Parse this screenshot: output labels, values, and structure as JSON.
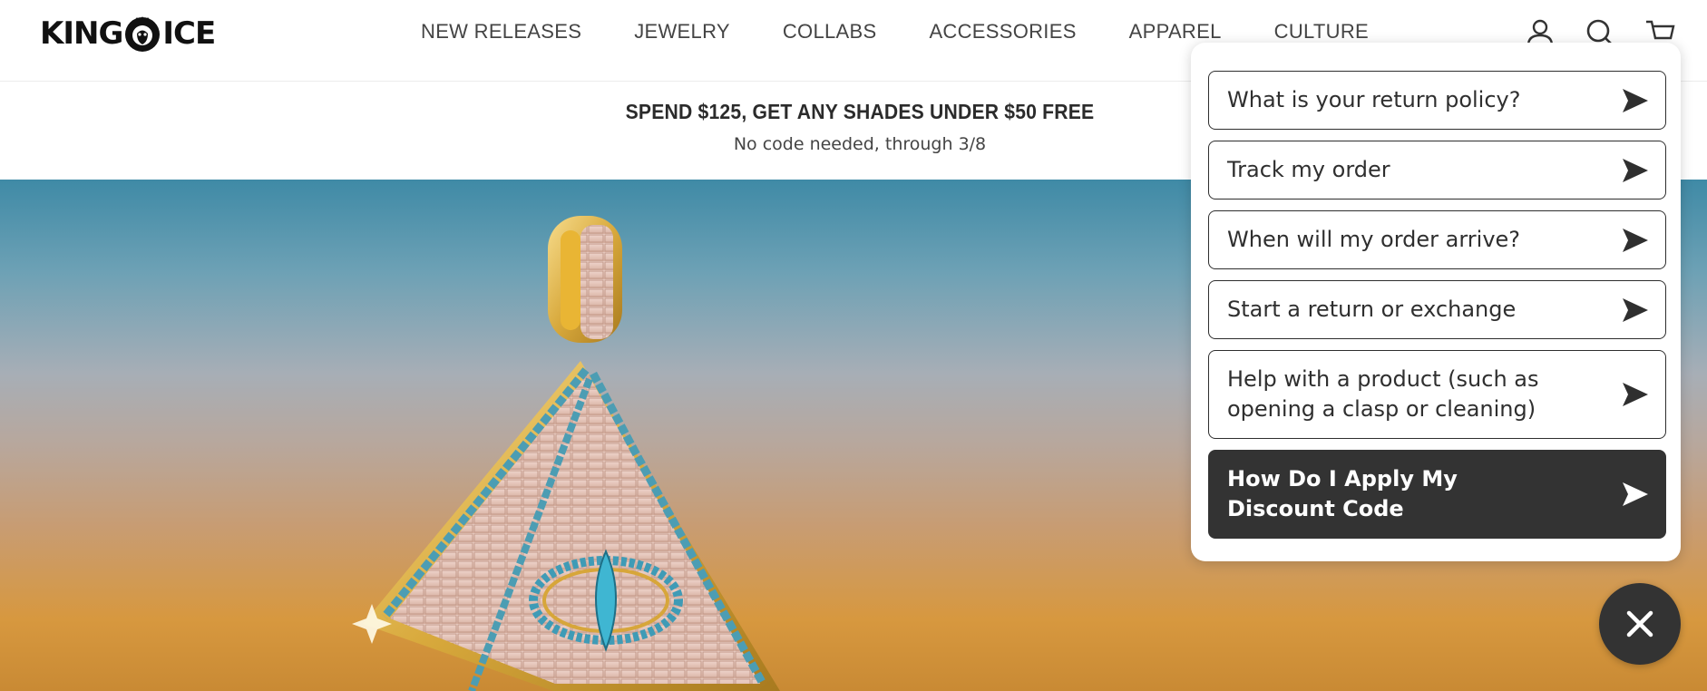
{
  "brand": {
    "logo_text_left": "KING",
    "logo_text_right": "ICE"
  },
  "nav": {
    "items": [
      {
        "label": "NEW RELEASES"
      },
      {
        "label": "JEWELRY"
      },
      {
        "label": "COLLABS"
      },
      {
        "label": "ACCESSORIES"
      },
      {
        "label": "APPAREL"
      },
      {
        "label": "CULTURE"
      }
    ]
  },
  "header_icons": [
    "account-icon",
    "search-icon",
    "cart-icon"
  ],
  "announcement": {
    "title": "SPEND $125, GET ANY SHADES UNDER $50 FREE",
    "subtitle": "No code needed, through 3/8"
  },
  "chat": {
    "options": [
      {
        "label": "What is your return policy?"
      },
      {
        "label": "Track my order"
      },
      {
        "label": "When will my order arrive?"
      },
      {
        "label": "Start a return or exchange"
      },
      {
        "label": "Help with a product (such as opening a clasp or cleaning)"
      },
      {
        "label": "How Do I Apply My Discount Code"
      }
    ],
    "send_icon": "send-icon",
    "close_icon": "close-icon"
  },
  "colors": {
    "chat_dark": "#333333",
    "hero_sky_top": "#3f8aa6",
    "hero_sky_bottom": "#d7983f"
  }
}
